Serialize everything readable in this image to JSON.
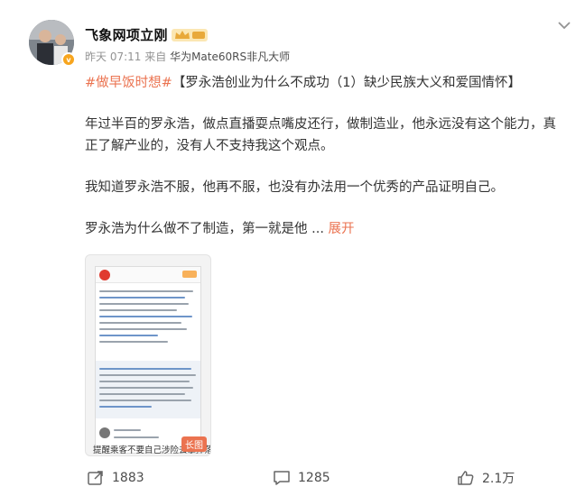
{
  "author": {
    "name": "飞象网项立刚",
    "badge": "v"
  },
  "meta": {
    "time": "昨天 07:11",
    "source_prefix": "来自",
    "source": "华为Mate60RS非凡大师"
  },
  "post": {
    "topic": "#做早饭时想#",
    "title": "【罗永浩创业为什么不成功（1）缺少民族大义和爱国情怀】",
    "paragraph1": "年过半百的罗永浩，做点直播耍点嘴皮还行，做制造业，他永远没有这个能力，真正了解产业的，没有人不支持我这个观点。",
    "paragraph2": "我知道罗永浩不服，他再不服，也没有办法用一个优秀的产品证明自己。",
    "paragraph3": "罗永浩为什么做不了制造，第一就是他",
    "ellipsis": " ... ",
    "expand_label": "展开"
  },
  "image": {
    "caption": "提醒乘客不要自己涉险去拿掉落物",
    "long_label": "长图"
  },
  "actions": {
    "repost_count": "1883",
    "comment_count": "1285",
    "like_count": "2.1万"
  },
  "colors": {
    "accent": "#eb7350",
    "badge": "#f7a51e"
  },
  "icons": {
    "more": "chevron-down-icon",
    "repost": "repost-icon",
    "comment": "comment-icon",
    "like": "thumbs-up-icon",
    "crown": "crown-icon"
  }
}
